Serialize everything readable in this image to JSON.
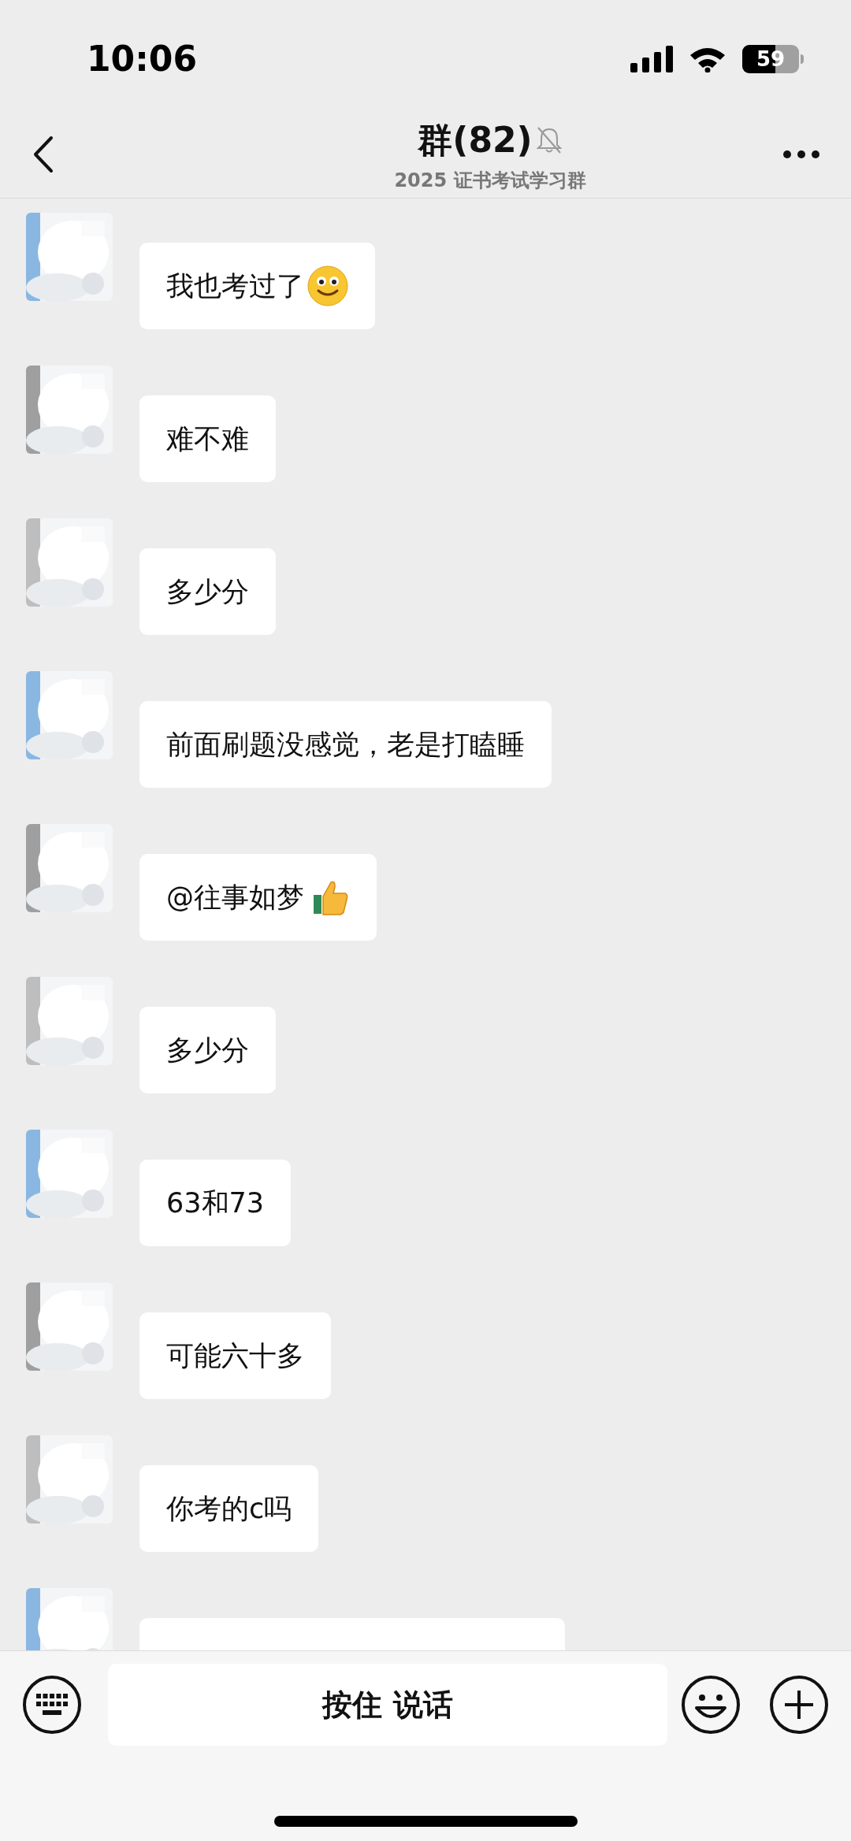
{
  "status_bar": {
    "time": "10:06",
    "battery": "59"
  },
  "header": {
    "title": "群(82)",
    "muted": true,
    "subtitle": "2025 证书考试学习群"
  },
  "messages": [
    {
      "kind": "smile",
      "text": "我也考过了"
    },
    {
      "kind": "plain",
      "text": "难不难"
    },
    {
      "kind": "plain",
      "text": "多少分"
    },
    {
      "kind": "plain",
      "text": "前面刷题没感觉，老是打瞌睡"
    },
    {
      "kind": "thumbsup",
      "text": "@往事如梦"
    },
    {
      "kind": "plain",
      "text": "多少分"
    },
    {
      "kind": "plain",
      "text": "63和73"
    },
    {
      "kind": "plain",
      "text": "可能六十多"
    },
    {
      "kind": "plain",
      "text": "你考的c吗"
    },
    {
      "kind": "cut"
    }
  ],
  "input_bar": {
    "talk_button": "按住 说话"
  }
}
